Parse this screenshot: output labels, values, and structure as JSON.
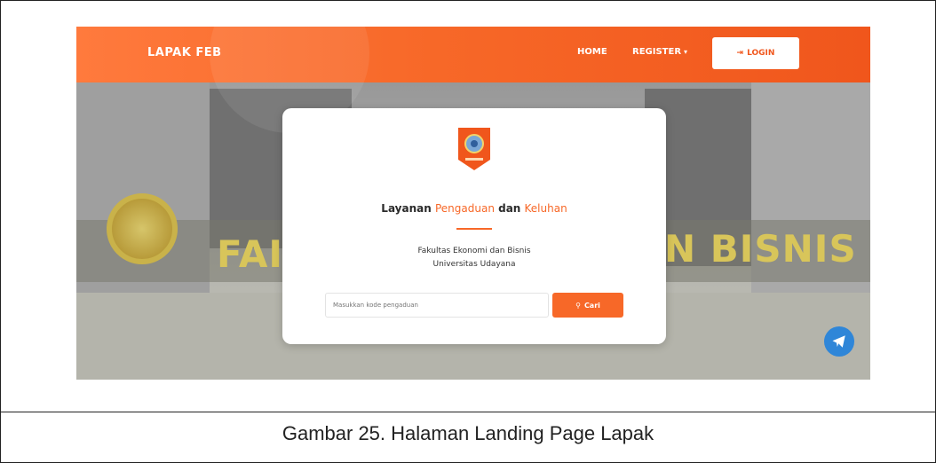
{
  "navbar": {
    "brand": "LAPAK FEB",
    "links": {
      "home": "HOME",
      "register": "REGISTER"
    },
    "login_label": "LOGIN",
    "icons": {
      "login": "login-icon",
      "dropdown": "chevron-down-icon"
    },
    "colors": {
      "start": "#ff7a3d",
      "end": "#f0561c"
    }
  },
  "background": {
    "text_left": "FAI",
    "text_right": "N BISNIS"
  },
  "card": {
    "title_parts": [
      "Layanan",
      "Pengaduan",
      "dan",
      "Keluhan"
    ],
    "subtitle_line1": "Fakultas Ekonomi dan Bisnis",
    "subtitle_line2": "Universitas Udayana",
    "search": {
      "placeholder": "Masukkan kode pengaduan",
      "button_label": "Cari",
      "icon": "search-icon"
    },
    "accent_color": "#f76828"
  },
  "fab": {
    "icon": "telegram-icon",
    "color": "#2f86d8"
  },
  "caption": "Gambar 25. Halaman Landing Page Lapak"
}
